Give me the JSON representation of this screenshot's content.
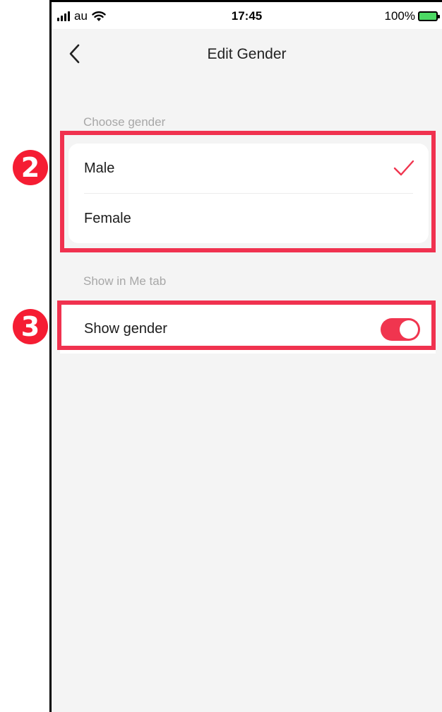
{
  "status_bar": {
    "carrier": "au",
    "time": "17:45",
    "battery_percent": "100%"
  },
  "nav": {
    "title": "Edit Gender",
    "back_icon": "chevron-left-icon"
  },
  "gender_section": {
    "header": "Choose gender",
    "options": [
      {
        "label": "Male",
        "selected": true
      },
      {
        "label": "Female",
        "selected": false
      }
    ]
  },
  "me_tab_section": {
    "header": "Show in Me tab",
    "toggle_label": "Show gender",
    "toggle_on": true
  },
  "annotations": {
    "step_2": "2",
    "step_3": "3"
  },
  "colors": {
    "accent": "#f0354f",
    "highlight": "#f0324f",
    "badge": "#f51d33"
  }
}
